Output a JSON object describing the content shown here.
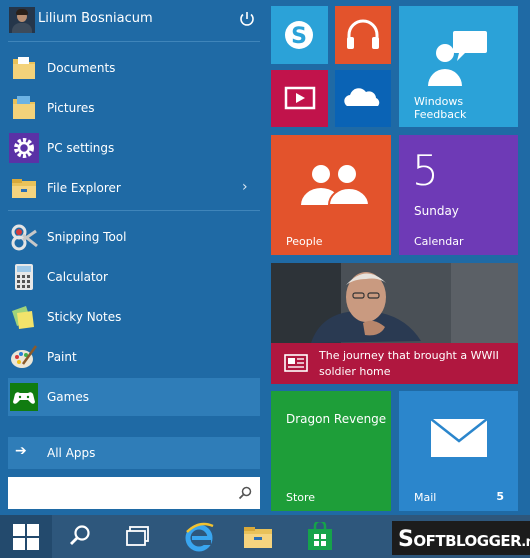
{
  "user": {
    "name": "Lilium Bosniacum"
  },
  "left_menu": [
    {
      "label": "Documents",
      "icon": "documents-folder-icon"
    },
    {
      "label": "Pictures",
      "icon": "pictures-folder-icon"
    },
    {
      "label": "PC settings",
      "icon": "gear-icon"
    },
    {
      "label": "File Explorer",
      "icon": "file-explorer-icon",
      "has_submenu": true
    },
    {
      "label": "Snipping Tool",
      "icon": "snipping-tool-icon"
    },
    {
      "label": "Calculator",
      "icon": "calculator-icon"
    },
    {
      "label": "Sticky Notes",
      "icon": "sticky-notes-icon"
    },
    {
      "label": "Paint",
      "icon": "paint-icon"
    },
    {
      "label": "Games",
      "icon": "games-icon",
      "highlighted": true
    }
  ],
  "all_apps": {
    "label": "All Apps"
  },
  "search": {
    "value": "",
    "placeholder": ""
  },
  "tiles": {
    "skype": {
      "icon": "skype-icon",
      "color": "#2ba2d8"
    },
    "music": {
      "icon": "headphones-icon",
      "color": "#e3532c"
    },
    "video": {
      "icon": "video-icon",
      "color": "#c1134b"
    },
    "onedrive": {
      "icon": "cloud-icon",
      "color": "#0a63b5"
    },
    "feedback": {
      "line1": "Windows",
      "line2": "Feedback",
      "color": "#2ba2d8"
    },
    "people": {
      "label": "People",
      "color": "#e3532c"
    },
    "calendar": {
      "day_number": "5",
      "day_name": "Sunday",
      "label": "Calendar",
      "color": "#6e3ab6"
    },
    "news": {
      "headline": "The journey that brought a WWII soldier home",
      "color": "#b0173f"
    },
    "store": {
      "title": "Dragon Revenge",
      "label": "Store",
      "color": "#1e9e39"
    },
    "mail": {
      "label": "Mail",
      "count": "5",
      "color": "#2b86cc"
    }
  },
  "taskbar": {
    "items": [
      "start-button",
      "search-icon",
      "task-view-icon",
      "internet-explorer-icon",
      "file-explorer-icon",
      "store-icon"
    ],
    "watermark": {
      "prefix": "S",
      "text": "OFTBLOGGER",
      "suffix": ".net"
    }
  }
}
